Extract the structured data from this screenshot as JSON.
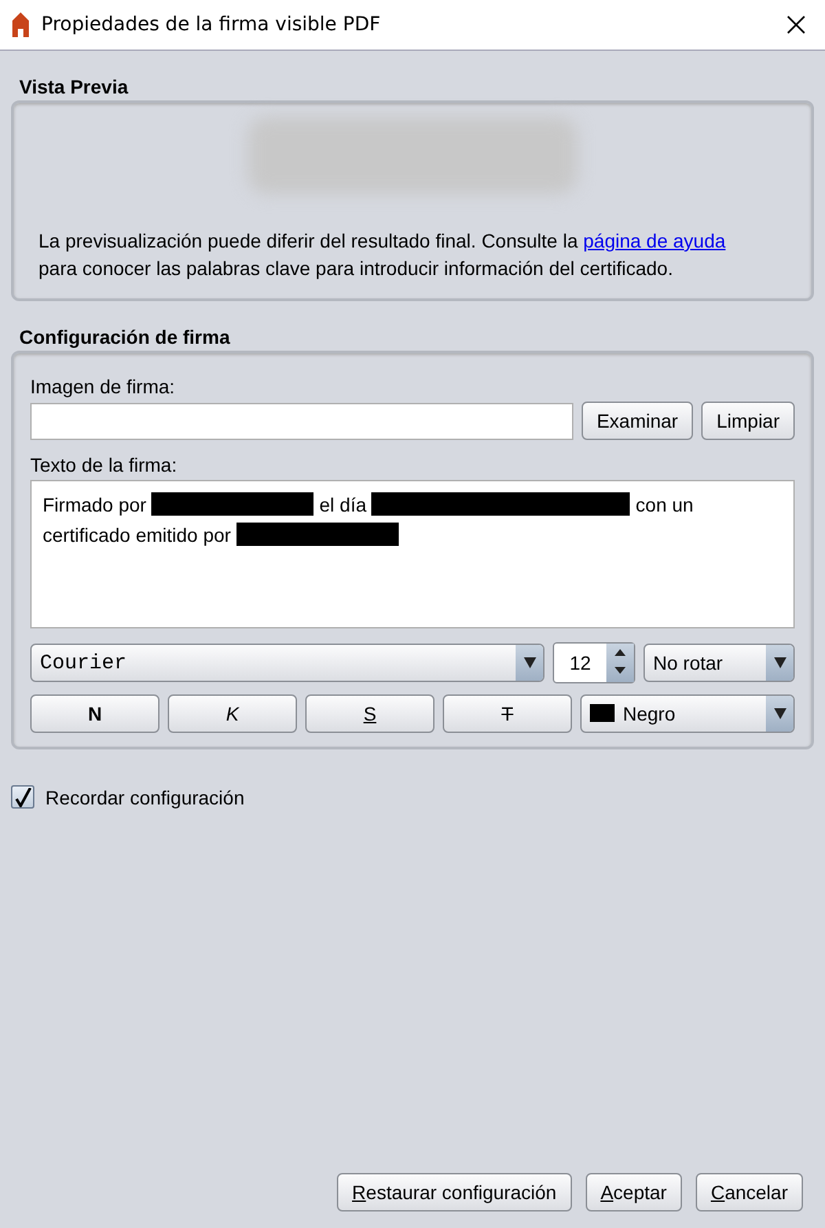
{
  "window": {
    "title": "Propiedades de la firma visible PDF"
  },
  "preview": {
    "heading": "Vista Previa",
    "note_before": "La previsualización puede diferir del resultado final. Consulte la ",
    "link": "página de ayuda",
    "note_after": " para conocer las palabras clave para introducir información del certificado."
  },
  "config": {
    "heading": "Configuración de firma",
    "image_label": "Imagen de firma:",
    "image_buttons": [
      "Examinar",
      "Limpiar"
    ],
    "text_label": "Texto de la firma:",
    "text_segments": [
      {
        "kind": "text",
        "text": "Firmado por"
      },
      {
        "kind": "redaction"
      },
      {
        "kind": "text",
        "text": "el día"
      },
      {
        "kind": "long_redaction"
      },
      {
        "kind": "text",
        "text": "con un certificado emitido por"
      },
      {
        "kind": "redaction"
      }
    ],
    "font": "Courier",
    "size": "12",
    "rotation": "No rotar",
    "style_buttons": [
      {
        "kind": "bold",
        "label": "N"
      },
      {
        "kind": "italic",
        "label": "K"
      },
      {
        "kind": "underline",
        "label": "S"
      },
      {
        "kind": "strike",
        "label": "T"
      }
    ],
    "color": {
      "label": "Negro",
      "color": "#000000"
    }
  },
  "remember": {
    "label": "Recordar configuración",
    "checked": true
  },
  "buttons": [
    "Restaurar configuración",
    "Aceptar",
    "Cancelar"
  ]
}
